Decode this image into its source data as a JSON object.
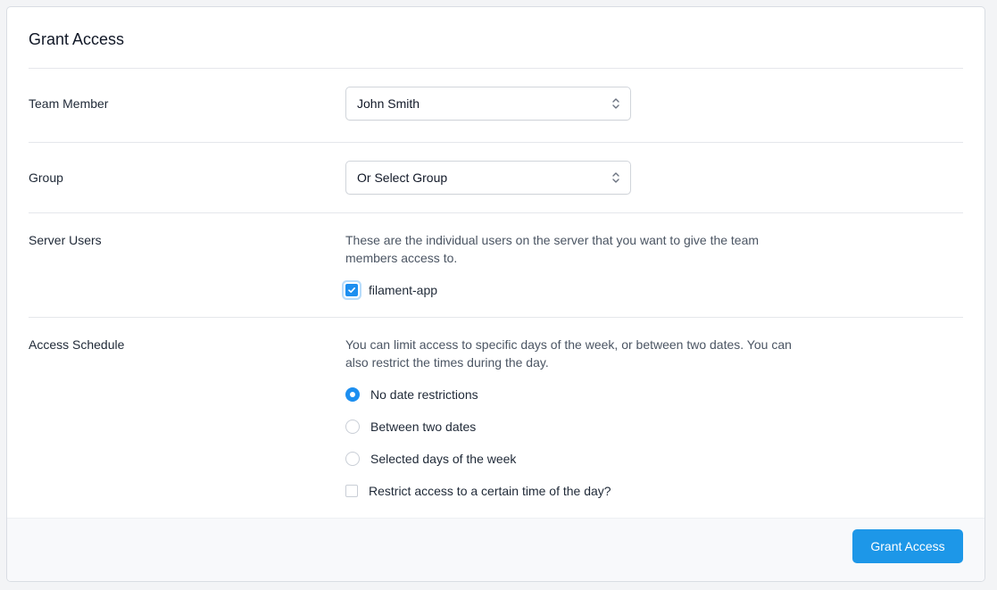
{
  "form": {
    "title": "Grant Access",
    "team_member": {
      "label": "Team Member",
      "value": "John Smith"
    },
    "group": {
      "label": "Group",
      "value": "Or Select Group"
    },
    "server_users": {
      "label": "Server Users",
      "help": "These are the individual users on the server that you want to give the team members access to.",
      "options": [
        {
          "label": "filament-app",
          "checked": true
        }
      ]
    },
    "access_schedule": {
      "label": "Access Schedule",
      "help": "You can limit access to specific days of the week, or between two dates. You can also restrict the times during the day.",
      "radios": [
        {
          "label": "No date restrictions",
          "checked": true
        },
        {
          "label": "Between two dates",
          "checked": false
        },
        {
          "label": "Selected days of the week",
          "checked": false
        }
      ],
      "time_restriction": {
        "label": "Restrict access to a certain time of the day?",
        "checked": false
      }
    },
    "submit_label": "Grant Access"
  },
  "icons": {
    "select_chevron": "chevron-up-down-icon",
    "check": "checkmark-icon"
  },
  "colors": {
    "accent": "#1d8ff0",
    "button": "#1d97e8"
  }
}
